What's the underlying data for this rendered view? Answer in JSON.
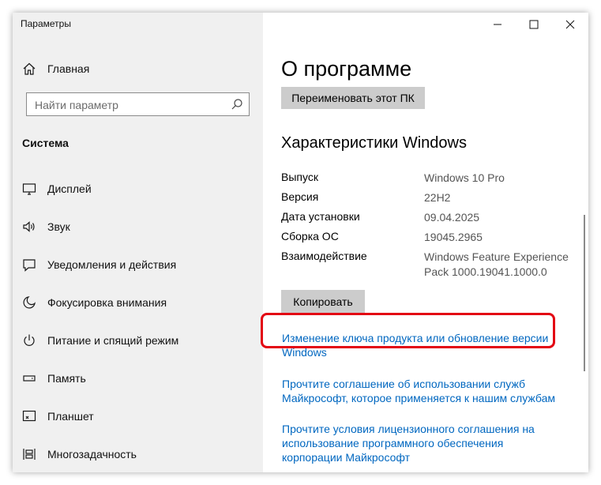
{
  "window": {
    "title": "Параметры",
    "controls": {
      "minimize": "minimize",
      "maximize": "maximize",
      "close": "close"
    }
  },
  "sidebar": {
    "home_label": "Главная",
    "search_placeholder": "Найти параметр",
    "section_title": "Система",
    "items": [
      {
        "label": "Дисплей",
        "icon": "display-icon"
      },
      {
        "label": "Звук",
        "icon": "speaker-icon"
      },
      {
        "label": "Уведомления и действия",
        "icon": "notification-icon"
      },
      {
        "label": "Фокусировка внимания",
        "icon": "moon-icon"
      },
      {
        "label": "Питание и спящий режим",
        "icon": "power-icon"
      },
      {
        "label": "Память",
        "icon": "storage-icon"
      },
      {
        "label": "Планшет",
        "icon": "tablet-icon"
      },
      {
        "label": "Многозадачность",
        "icon": "multitasking-icon"
      }
    ]
  },
  "main": {
    "page_title": "О программе",
    "rename_button": "Переименовать этот ПК",
    "specs_title": "Характеристики Windows",
    "specs": [
      {
        "key": "Выпуск",
        "value": "Windows 10 Pro"
      },
      {
        "key": "Версия",
        "value": "22H2"
      },
      {
        "key": "Дата установки",
        "value": "09.04.2025"
      },
      {
        "key": "Сборка ОС",
        "value": "19045.2965"
      },
      {
        "key": "Взаимодействие",
        "value": "Windows Feature Experience Pack 1000.19041.1000.0"
      }
    ],
    "copy_button": "Копировать",
    "links": [
      {
        "text": "Изменение ключа продукта или обновление версии Windows"
      },
      {
        "text": "Прочтите соглашение об использовании служб Майкрософт, которое применяется к нашим службам"
      },
      {
        "text": "Прочтите условия лицензионного соглашения на использование программного обеспечения корпорации Майкрософт"
      }
    ]
  },
  "colors": {
    "accent_link": "#0067c0",
    "highlight": "#e30613",
    "sidebar_bg": "#f0f0f0",
    "button_bg": "#cccccc"
  }
}
